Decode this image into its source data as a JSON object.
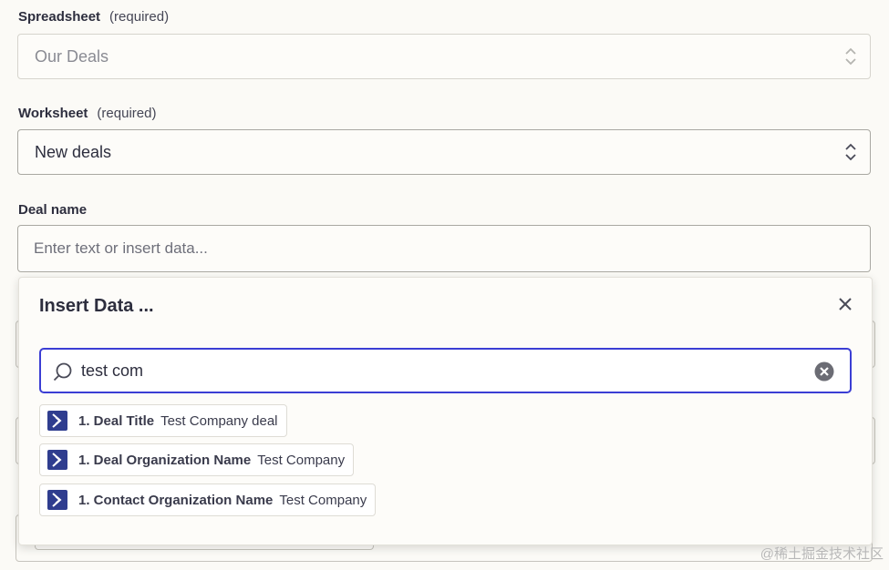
{
  "spreadsheet": {
    "label": "Spreadsheet",
    "required": "(required)",
    "value": "Our Deals"
  },
  "worksheet": {
    "label": "Worksheet",
    "required": "(required)",
    "value": "New deals"
  },
  "deal_name": {
    "label": "Deal name",
    "placeholder": "Enter text or insert data..."
  },
  "insert_popup": {
    "title": "Insert Data ...",
    "search_value": "test com",
    "results": [
      {
        "key": "1. Deal Title",
        "value": "Test Company deal",
        "icon": "pipedrive-app-icon"
      },
      {
        "key": "1. Deal Organization Name",
        "value": "Test Company",
        "icon": "pipedrive-app-icon"
      },
      {
        "key": "1. Contact Organization Name",
        "value": "Test Company",
        "icon": "pipedrive-app-icon"
      }
    ]
  },
  "watermark": "@稀土掘金技术社区",
  "colors": {
    "accent": "#3b3ed4",
    "app_icon": "#2f3d8f",
    "background": "#fbfaf6"
  }
}
